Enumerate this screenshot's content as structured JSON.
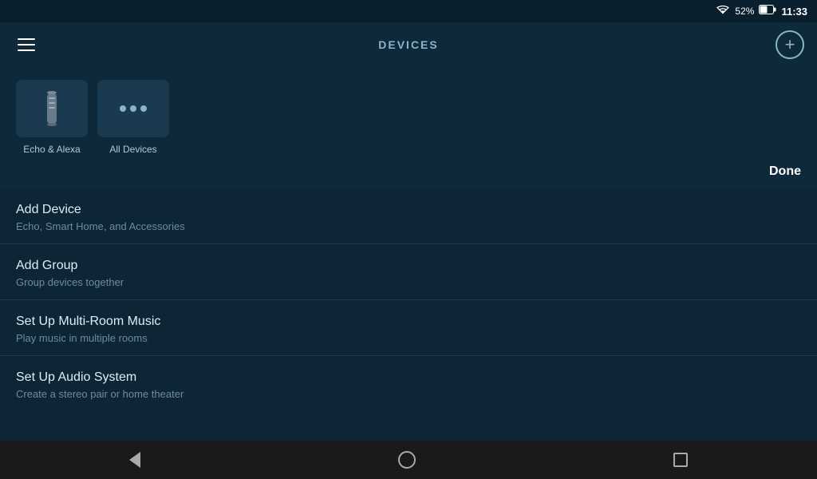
{
  "statusBar": {
    "batteryPercent": "52%",
    "time": "11:33"
  },
  "header": {
    "title": "DEVICES",
    "addButtonLabel": "+"
  },
  "devices": [
    {
      "id": "echo-alexa",
      "label": "Echo & Alexa",
      "iconType": "echo"
    },
    {
      "id": "all-devices",
      "label": "All Devices",
      "iconType": "dots"
    }
  ],
  "doneButton": {
    "label": "Done"
  },
  "menuItems": [
    {
      "title": "Add Device",
      "subtitle": "Echo, Smart Home, and Accessories"
    },
    {
      "title": "Add Group",
      "subtitle": "Group devices together"
    },
    {
      "title": "Set Up Multi-Room Music",
      "subtitle": "Play music in multiple rooms"
    },
    {
      "title": "Set Up Audio System",
      "subtitle": "Create a stereo pair or home theater"
    }
  ],
  "navBar": {
    "back": "back",
    "home": "home",
    "recent": "recent"
  }
}
